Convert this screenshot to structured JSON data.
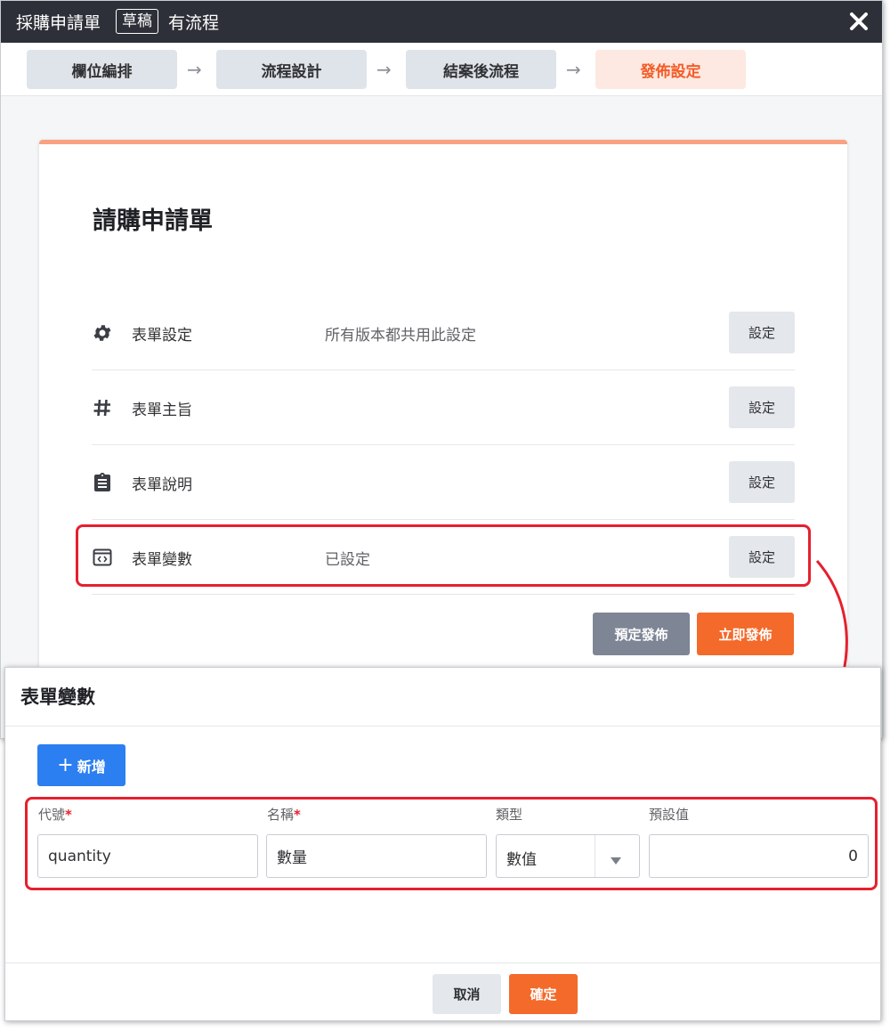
{
  "window": {
    "title": "採購申請單",
    "badge": "草稿",
    "subtitle": "有流程",
    "close_icon": "close-icon"
  },
  "steps": [
    {
      "label": "欄位編排",
      "active": false
    },
    {
      "label": "流程設計",
      "active": false
    },
    {
      "label": "結案後流程",
      "active": false
    },
    {
      "label": "發佈設定",
      "active": true
    }
  ],
  "card": {
    "title": "請購申請單",
    "rows": [
      {
        "icon": "gear-icon",
        "label": "表單設定",
        "note": "所有版本都共用此設定",
        "button": "設定"
      },
      {
        "icon": "hash-icon",
        "label": "表單主旨",
        "note": "",
        "button": "設定"
      },
      {
        "icon": "clipboard-icon",
        "label": "表單說明",
        "note": "",
        "button": "設定"
      },
      {
        "icon": "code-window-icon",
        "label": "表單變數",
        "note": "已設定",
        "button": "設定"
      }
    ],
    "schedule_button": "預定發佈",
    "publish_button": "立即發佈"
  },
  "dialog": {
    "title": "表單變數",
    "add_button": "新增",
    "fields": {
      "code_label": "代號",
      "name_label": "名稱",
      "type_label": "類型",
      "default_label": "預設值",
      "required_mark": "*"
    },
    "variable": {
      "code": "quantity",
      "name": "數量",
      "type": "數值",
      "default": "0"
    },
    "cancel_button": "取消",
    "ok_button": "確定"
  },
  "colors": {
    "accent": "#f36a2a",
    "primary": "#2b7ff0",
    "highlight": "#e5202e",
    "titlebar": "#2d3038"
  }
}
